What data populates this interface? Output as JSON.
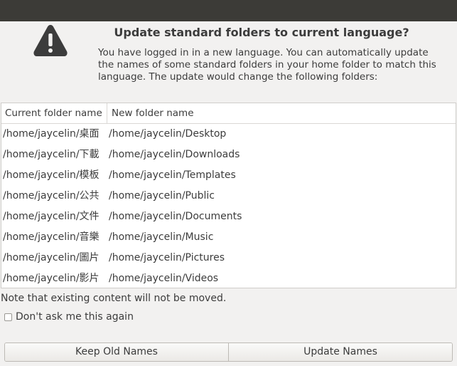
{
  "dialog": {
    "heading": "Update standard folders to current language?",
    "message": "You have logged in in a new language. You can automatically update the names of some standard folders in your home folder to match this language. The update would change the following folders:",
    "icon": "warning-icon"
  },
  "table": {
    "headers": [
      "Current folder name",
      "New folder name"
    ],
    "rows": [
      [
        "/home/jaycelin/桌面",
        "/home/jaycelin/Desktop"
      ],
      [
        "/home/jaycelin/下載",
        "/home/jaycelin/Downloads"
      ],
      [
        "/home/jaycelin/模板",
        "/home/jaycelin/Templates"
      ],
      [
        "/home/jaycelin/公共",
        "/home/jaycelin/Public"
      ],
      [
        "/home/jaycelin/文件",
        "/home/jaycelin/Documents"
      ],
      [
        "/home/jaycelin/音樂",
        "/home/jaycelin/Music"
      ],
      [
        "/home/jaycelin/圖片",
        "/home/jaycelin/Pictures"
      ],
      [
        "/home/jaycelin/影片",
        "/home/jaycelin/Videos"
      ]
    ]
  },
  "note": "Note that existing content will not be moved.",
  "checkbox": {
    "label": "Don't ask me this again",
    "checked": false
  },
  "buttons": {
    "keep": "Keep Old Names",
    "update": "Update Names"
  },
  "colors": {
    "titlebar": "#3c3b37",
    "background": "#f2f1f0",
    "icon": "#3c3c3c"
  }
}
